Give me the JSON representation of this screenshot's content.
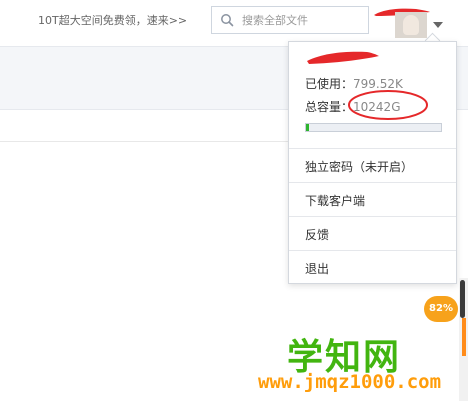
{
  "header": {
    "promo_text": "10T超大空间免费领，速来>>",
    "search": {
      "placeholder": "搜索全部文件",
      "value": ""
    },
    "avatar_icon": "user-avatar",
    "caret_icon": "chevron-down-icon"
  },
  "user_menu": {
    "used_label": "已使用：",
    "used_value": "799.52K",
    "total_label": "总容量：",
    "total_value": "10242G",
    "usage_fraction": 0.02,
    "items": [
      {
        "label": "独立密码（未开启）"
      },
      {
        "label": "下载客户端"
      },
      {
        "label": "反馈"
      },
      {
        "label": "退出"
      }
    ]
  },
  "progress_bubble": {
    "text": "82%"
  },
  "watermark": {
    "title": "学知网",
    "url": "www.jmqz1000.com"
  },
  "colors": {
    "usage_fill": "#2fb52f",
    "annotation_red": "#e5282a",
    "bubble_orange": "#f7a21b",
    "watermark_green": "#42b510",
    "watermark_orange": "#ff9d0b"
  }
}
